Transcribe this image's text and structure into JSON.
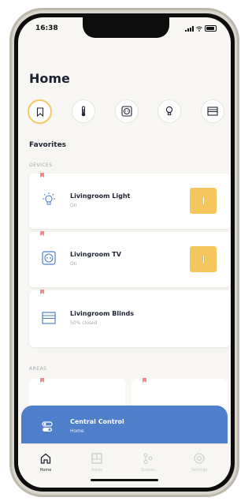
{
  "status": {
    "time": "16:38"
  },
  "page": {
    "title": "Home"
  },
  "categories": [
    {
      "icon": "bookmark-icon",
      "active": true
    },
    {
      "icon": "thermometer-icon",
      "active": false
    },
    {
      "icon": "outlet-icon",
      "active": false
    },
    {
      "icon": "bulb-icon",
      "active": false
    },
    {
      "icon": "blinds-icon",
      "active": false
    }
  ],
  "favorites": {
    "title": "Favorites",
    "devices_label": "DEVICES",
    "devices": [
      {
        "name": "Livingroom Light",
        "state": "On",
        "icon": "light-icon",
        "toggle_on": true
      },
      {
        "name": "Livingroom TV",
        "state": "On",
        "icon": "outlet-icon",
        "toggle_on": true
      },
      {
        "name": "Livingroom Blinds",
        "state": "50% closed",
        "icon": "blinds-icon",
        "toggle_on": false
      }
    ],
    "areas_label": "AREAS"
  },
  "central_control": {
    "title": "Central Control",
    "subtitle": "Home"
  },
  "tabbar": [
    {
      "label": "Home",
      "icon": "home-icon",
      "active": true
    },
    {
      "label": "Areas",
      "icon": "areas-icon",
      "active": false
    },
    {
      "label": "Scenes",
      "icon": "scenes-icon",
      "active": false
    },
    {
      "label": "Settings",
      "icon": "settings-icon",
      "active": false
    }
  ],
  "colors": {
    "accent": "#f4c75e",
    "primary": "#4f7fca",
    "pin": "#f28a8a"
  }
}
